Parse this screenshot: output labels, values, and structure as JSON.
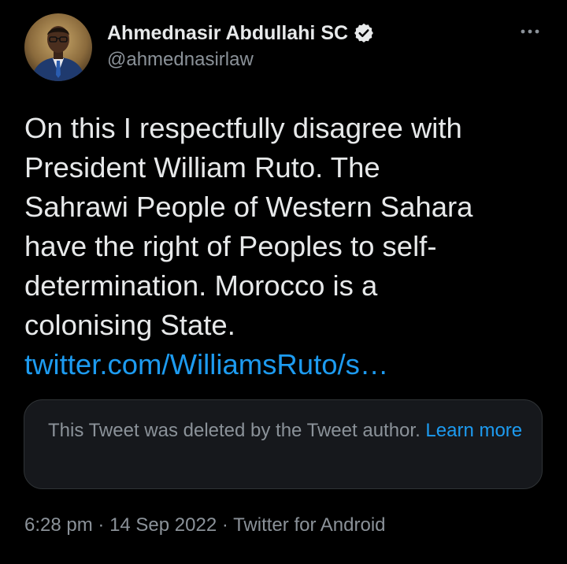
{
  "author": {
    "display_name": "Ahmednasir Abdullahi SC",
    "handle": "@ahmednasirlaw",
    "verified_icon": "verified-badge-icon",
    "avatar_icon": "profile-photo"
  },
  "more_icon": "more-dots-icon",
  "tweet": {
    "lines": [
      "On this I respectfully disagree with",
      "President William Ruto. The",
      "Sahrawi People of Western Sahara",
      "have the right of Peoples to self-",
      "determination. Morocco is a",
      "colonising State."
    ],
    "link": "twitter.com/WilliamsRuto/s…"
  },
  "quote": {
    "message": "This Tweet was deleted by the Tweet author.",
    "learn_more": "Learn more"
  },
  "meta": {
    "time": "6:28 pm",
    "separator": "·",
    "date": "14 Sep 2022",
    "source": "Twitter for Android"
  },
  "colors": {
    "background": "#000000",
    "primary_text": "#e7e9ea",
    "secondary_text": "#8b9299",
    "link": "#1d9bf0",
    "card_background": "#16181c"
  }
}
